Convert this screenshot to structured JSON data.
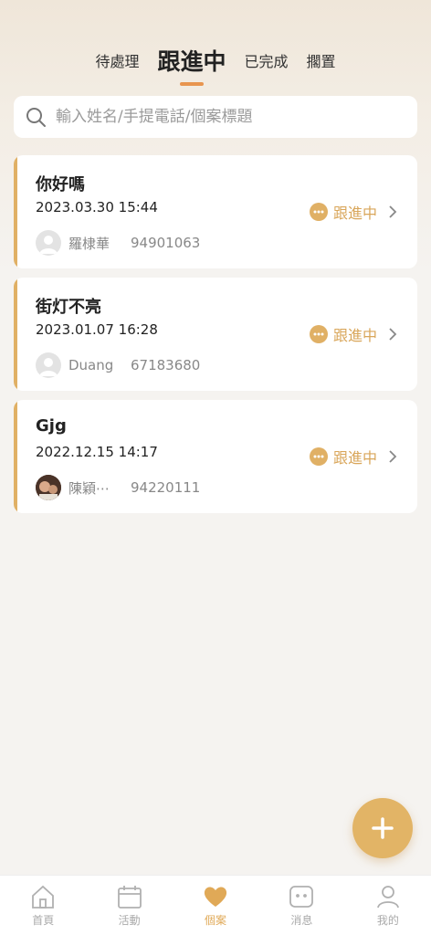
{
  "tabs": [
    {
      "label": "待處理",
      "active": false
    },
    {
      "label": "跟進中",
      "active": true
    },
    {
      "label": "已完成",
      "active": false
    },
    {
      "label": "擱置",
      "active": false
    }
  ],
  "search": {
    "placeholder": "輸入姓名/手提電話/個案標題",
    "value": ""
  },
  "cases": [
    {
      "title": "你好嗎",
      "date": "2023.03.30 15:44",
      "name": "羅棣華",
      "phone": "94901063",
      "status": "跟進中",
      "avatar": "default-avatar"
    },
    {
      "title": "街灯不亮",
      "date": "2023.01.07 16:28",
      "name": "Duang",
      "phone": "67183680",
      "status": "跟進中",
      "avatar": "default-avatar"
    },
    {
      "title": "Gjg",
      "date": "2022.12.15 14:17",
      "name": "陳穎⋯",
      "phone": "94220111",
      "status": "跟進中",
      "avatar": "photo-avatar"
    }
  ],
  "nav": [
    {
      "label": "首頁",
      "icon": "home-icon",
      "active": false
    },
    {
      "label": "活動",
      "icon": "calendar-icon",
      "active": false
    },
    {
      "label": "個案",
      "icon": "heart-icon",
      "active": true
    },
    {
      "label": "消息",
      "icon": "message-icon",
      "active": false
    },
    {
      "label": "我的",
      "icon": "profile-icon",
      "active": false
    }
  ],
  "colors": {
    "accent": "#e0b065",
    "tab_indicator": "#e8954f",
    "status": "#d9a65a",
    "fab": "#e2b466"
  }
}
